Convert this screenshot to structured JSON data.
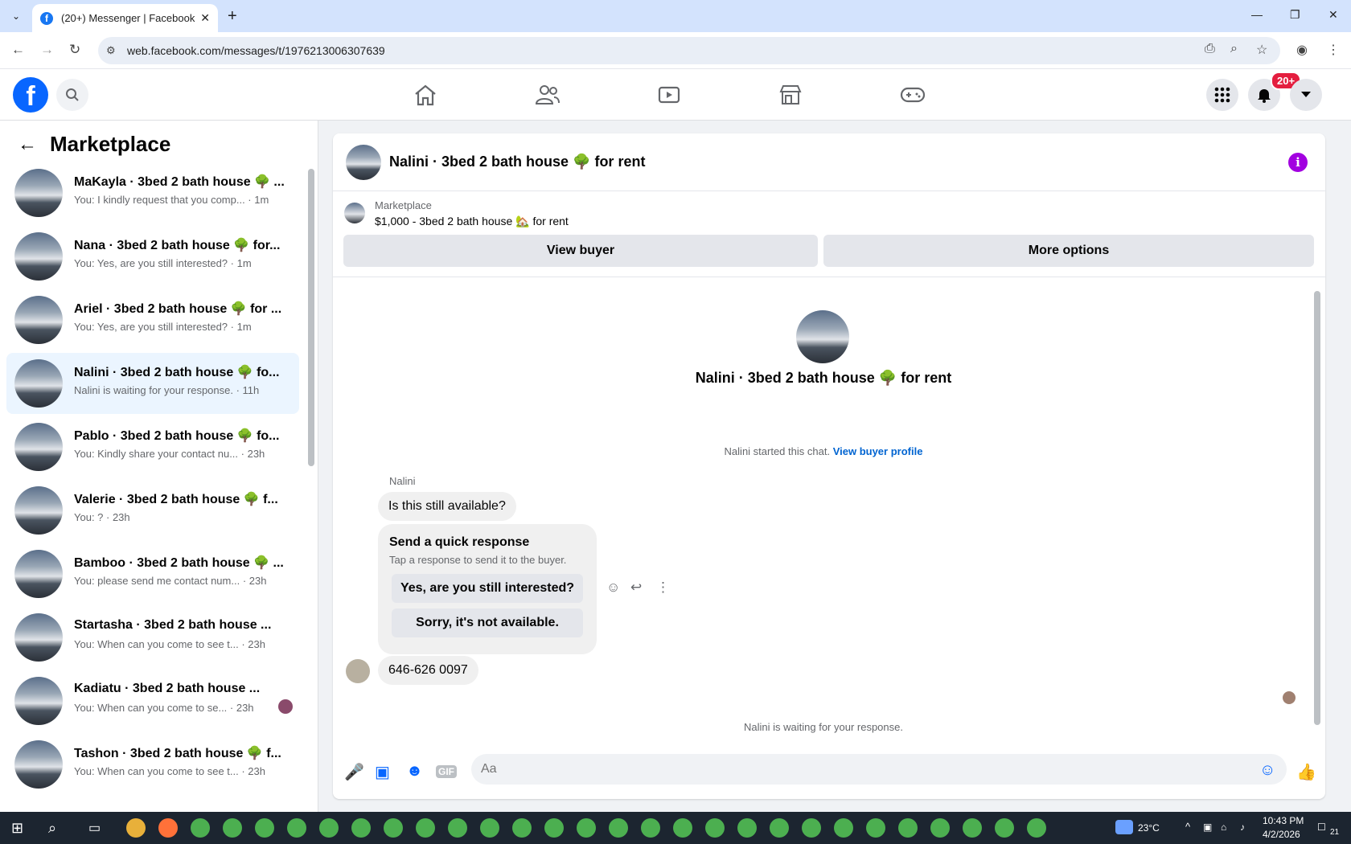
{
  "browser": {
    "tab_title": "(20+) Messenger | Facebook",
    "url": "web.facebook.com/messages/t/1976213006307639"
  },
  "header": {
    "notification_badge": "20+"
  },
  "sidebar": {
    "title": "Marketplace",
    "conversations": [
      {
        "title": "MaKayla · 3bed 2 bath house 🌳 ...",
        "snippet": "You: I kindly request that you comp... · 1m"
      },
      {
        "title": "Nana · 3bed 2 bath house 🌳 for...",
        "snippet": "You: Yes, are you still interested? · 1m"
      },
      {
        "title": "Ariel · 3bed 2 bath house 🌳 for ...",
        "snippet": "You: Yes, are you still interested? · 1m"
      },
      {
        "title": "Nalini · 3bed 2 bath house 🌳 fo...",
        "snippet": "Nalini is waiting for your response. · 11h"
      },
      {
        "title": "Pablo · 3bed 2 bath house 🌳 fo...",
        "snippet": "You: Kindly share your contact nu... · 23h"
      },
      {
        "title": "Valerie · 3bed 2 bath house 🌳 f...",
        "snippet": "You: ? · 23h"
      },
      {
        "title": "Bamboo · 3bed 2 bath house 🌳 ...",
        "snippet": "You: please send me contact num... · 23h"
      },
      {
        "title": "Startasha · 3bed 2 bath house ...",
        "snippet": "You: When can you come to see t... · 23h"
      },
      {
        "title": "Kadiatu · 3bed 2 bath house ...",
        "snippet": "You: When can you come to se... · 23h"
      },
      {
        "title": "Tashon · 3bed 2 bath house 🌳 f...",
        "snippet": "You: When can you come to see t... · 23h"
      }
    ]
  },
  "chat": {
    "header_title": "Nalini · 3bed 2 bath house 🌳 for rent",
    "listing_label": "Marketplace",
    "listing_title": "$1,000 - 3bed 2 bath house 🏡 for rent",
    "view_buyer": "View buyer",
    "more_options": "More options",
    "intro_title": "Nalini · 3bed 2 bath house 🌳 for rent",
    "started_text": "Nalini started this chat.",
    "view_buyer_profile": "View buyer profile",
    "sender_name": "Nalini",
    "message_1": "Is this still available?",
    "quick_title": "Send a quick response",
    "quick_sub": "Tap a response to send it to the buyer.",
    "quick_opt_1": "Yes, are you still interested?",
    "quick_opt_2": "Sorry, it's not available.",
    "message_2": "646-626 0097",
    "waiting": "Nalini is waiting for your response.",
    "composer_placeholder": "Aa"
  },
  "taskbar": {
    "weather": "23°C",
    "time": "10:43 PM",
    "date": "4/2/2026",
    "notifications": "21"
  },
  "colors": {
    "brand": "#0866ff",
    "active_conv": "#ebf5ff",
    "info": "#a200e0"
  }
}
